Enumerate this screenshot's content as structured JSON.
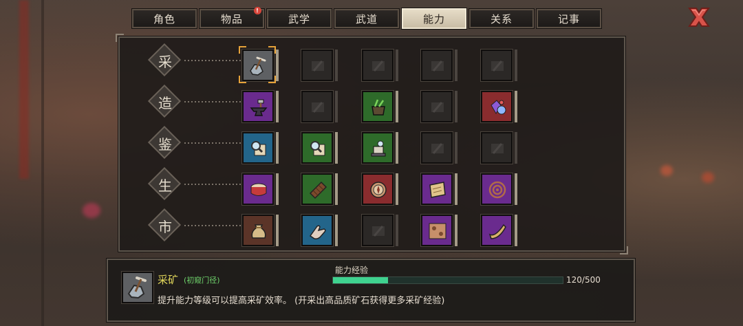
{
  "tabs": [
    {
      "label": "角色",
      "active": false,
      "badge": ""
    },
    {
      "label": "物品",
      "active": false,
      "badge": "!"
    },
    {
      "label": "武学",
      "active": false,
      "badge": ""
    },
    {
      "label": "武道",
      "active": false,
      "badge": ""
    },
    {
      "label": "能力",
      "active": true,
      "badge": ""
    },
    {
      "label": "关系",
      "active": false,
      "badge": ""
    },
    {
      "label": "记事",
      "active": false,
      "badge": ""
    }
  ],
  "close_icon": "close-x-icon",
  "rows": [
    {
      "label": "采",
      "slots": [
        {
          "icon": "pickaxe-ore-icon",
          "rarity": "grey",
          "locked": false,
          "selected": true
        },
        {
          "icon": "locked-gather-icon",
          "rarity": "locked",
          "locked": true
        },
        {
          "icon": "locked-gather-icon",
          "rarity": "locked",
          "locked": true
        },
        {
          "icon": "locked-gather-icon",
          "rarity": "locked",
          "locked": true
        },
        {
          "icon": "locked-gather-icon",
          "rarity": "locked",
          "locked": true
        }
      ]
    },
    {
      "label": "造",
      "slots": [
        {
          "icon": "anvil-hammer-icon",
          "rarity": "purple",
          "locked": false
        },
        {
          "icon": "locked-craft-icon",
          "rarity": "locked",
          "locked": true
        },
        {
          "icon": "herb-cauldron-icon",
          "rarity": "green",
          "locked": false
        },
        {
          "icon": "locked-craft-icon",
          "rarity": "locked",
          "locked": true
        },
        {
          "icon": "gem-crystal-icon",
          "rarity": "red",
          "locked": false
        }
      ]
    },
    {
      "label": "鉴",
      "slots": [
        {
          "icon": "magnifier-scroll-icon",
          "rarity": "blue",
          "locked": false
        },
        {
          "icon": "magnifier-scroll-icon",
          "rarity": "green",
          "locked": false
        },
        {
          "icon": "appraisal-stand-icon",
          "rarity": "green",
          "locked": false
        },
        {
          "icon": "locked-appraise-icon",
          "rarity": "locked",
          "locked": true
        },
        {
          "icon": "locked-appraise-icon",
          "rarity": "locked",
          "locked": true
        }
      ]
    },
    {
      "label": "生",
      "slots": [
        {
          "icon": "drum-icon",
          "rarity": "purple",
          "locked": false
        },
        {
          "icon": "chocolate-bar-icon",
          "rarity": "green",
          "locked": false
        },
        {
          "icon": "compass-icon",
          "rarity": "red",
          "locked": false
        },
        {
          "icon": "map-scroll-icon",
          "rarity": "purple",
          "locked": false
        },
        {
          "icon": "rope-coil-icon",
          "rarity": "purple",
          "locked": false
        }
      ]
    },
    {
      "label": "市",
      "slots": [
        {
          "icon": "coin-bag-icon",
          "rarity": "brown",
          "locked": false
        },
        {
          "icon": "hand-point-icon",
          "rarity": "blue",
          "locked": false
        },
        {
          "icon": "locked-market-icon",
          "rarity": "locked",
          "locked": true
        },
        {
          "icon": "cloth-pattern-icon",
          "rarity": "purple",
          "locked": false
        },
        {
          "icon": "horn-icon",
          "rarity": "purple",
          "locked": false
        }
      ]
    }
  ],
  "detail": {
    "icon": "pickaxe-ore-icon",
    "name": "采矿",
    "rank": "(初窥门径)",
    "description": "提升能力等级可以提高采矿效率。 (开采出高品质矿石获得更多采矿经验)",
    "xp_label": "能力经验",
    "xp_current": 120,
    "xp_max": 500,
    "xp_text": "120/500"
  },
  "colors": {
    "accent_select": "#e7a33a",
    "xp_fill": "#3fd28f",
    "name_yellow": "#e2d75b",
    "rank_green": "#6fd46c",
    "badge_red": "#d8463b"
  }
}
